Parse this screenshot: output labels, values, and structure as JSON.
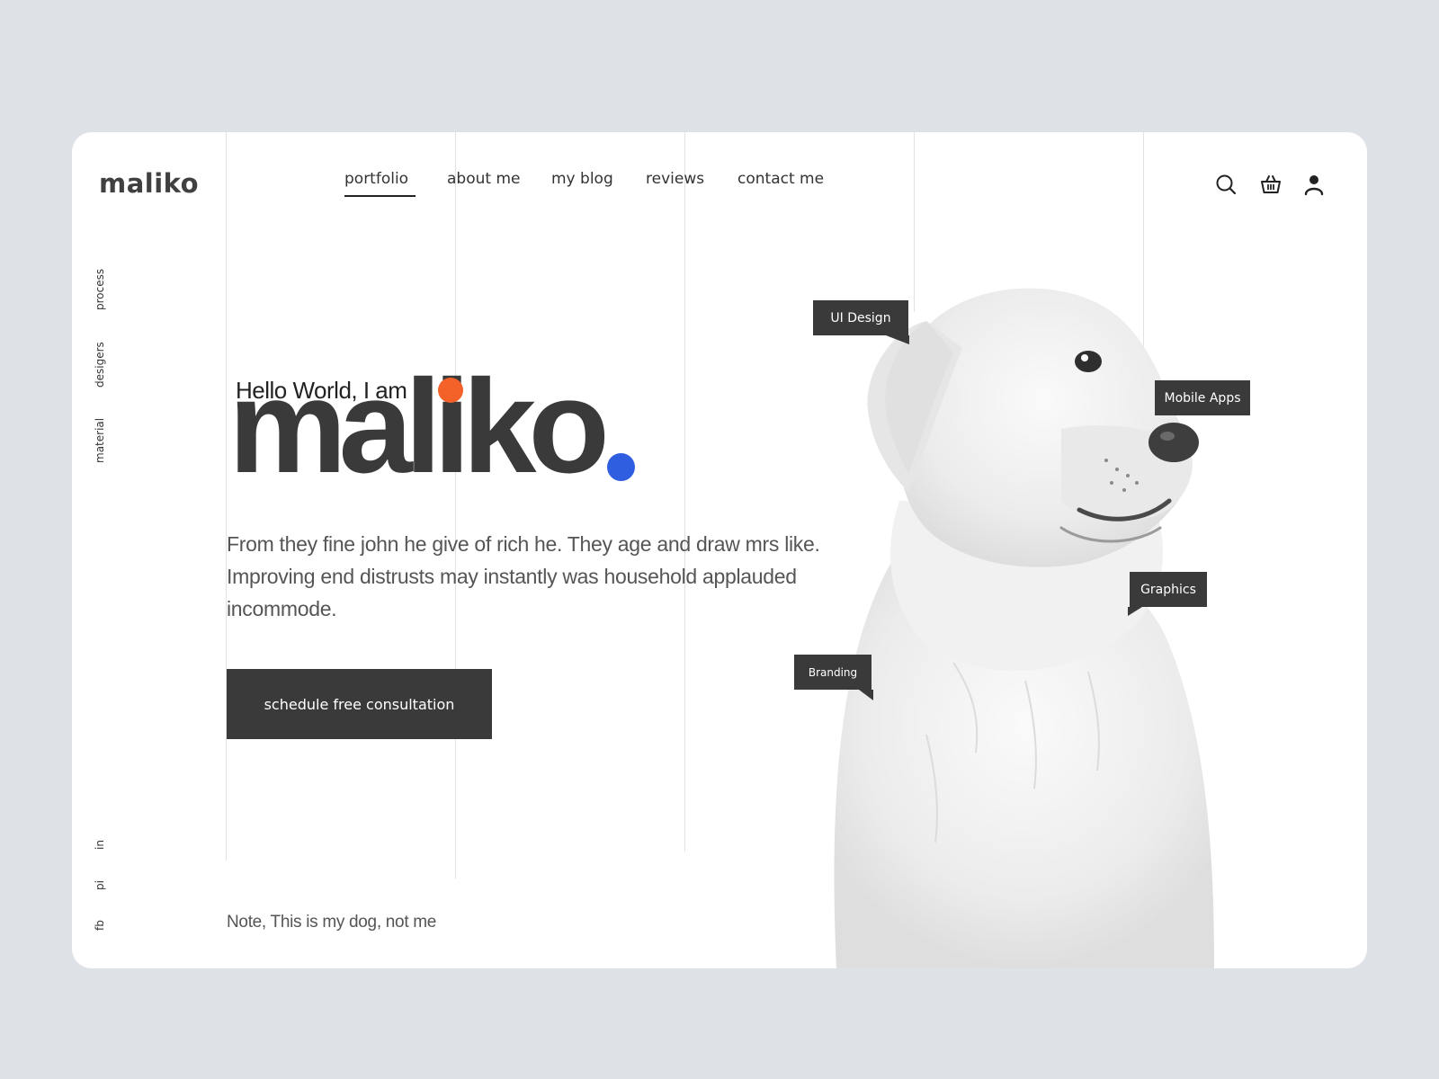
{
  "brand": {
    "logo": "maliko"
  },
  "nav": {
    "items": [
      {
        "label": "portfolio",
        "active": true
      },
      {
        "label": "about me",
        "active": false
      },
      {
        "label": "my blog",
        "active": false
      },
      {
        "label": "reviews",
        "active": false
      },
      {
        "label": "contact me",
        "active": false
      }
    ]
  },
  "header_icons": [
    "search-icon",
    "basket-icon",
    "user-icon"
  ],
  "side_nav": {
    "items": [
      "process",
      "desigers",
      "material"
    ]
  },
  "social": {
    "items": [
      "in",
      "pi",
      "fb"
    ]
  },
  "hero": {
    "greeting": "Hello World, I am",
    "name": "maliko",
    "name_period_color": "#2f5ee0",
    "i_dot_color": "#f4622a",
    "description": "From they fine john he give of rich he. They age and draw mrs like. Improving end distrusts may instantly was household applauded incommode.",
    "cta_label": "schedule free consultation",
    "note": "Note, This is my dog, not me"
  },
  "tags": {
    "ui_design": "UI Design",
    "mobile_apps": "Mobile Apps",
    "graphics": "Graphics",
    "branding": "Branding"
  },
  "colors": {
    "background": "#dee1e6",
    "card": "#ffffff",
    "dark": "#3a3a3a"
  }
}
